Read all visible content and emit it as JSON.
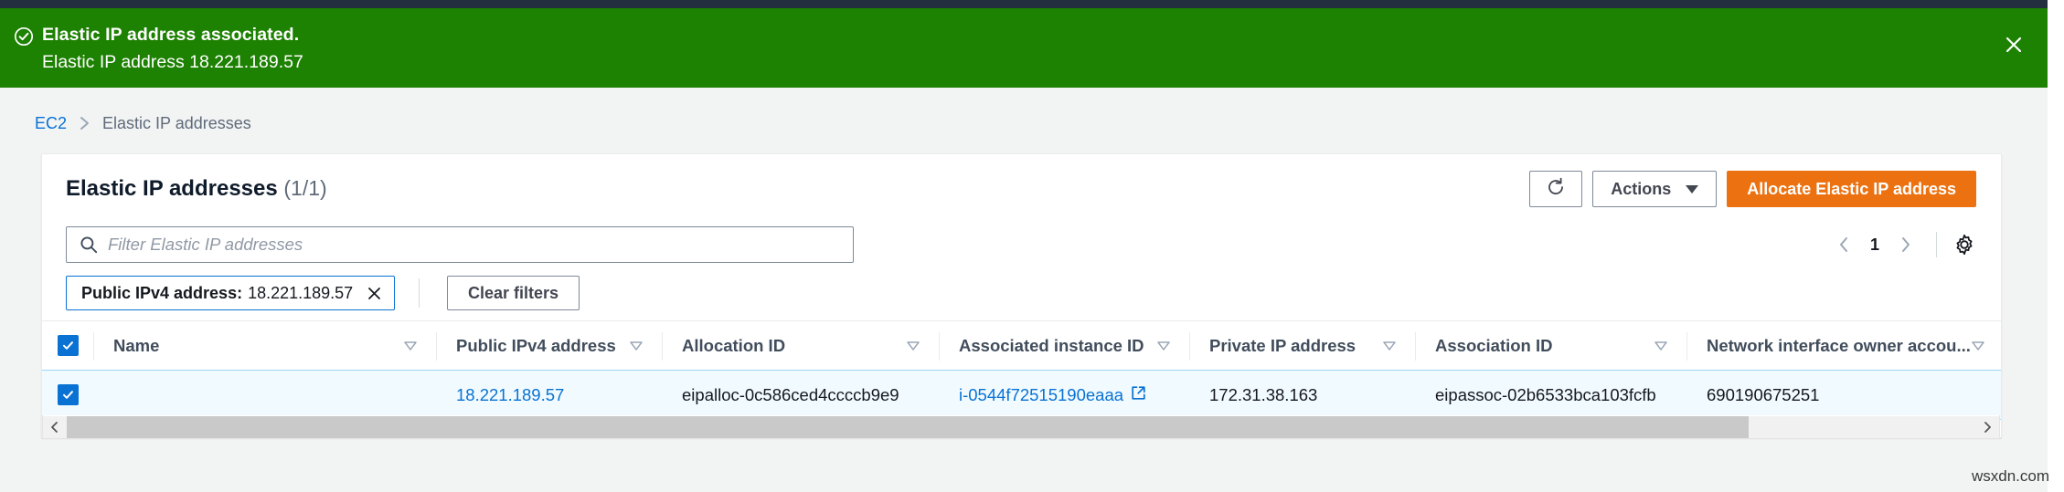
{
  "flash": {
    "title": "Elastic IP address associated.",
    "subtitle": "Elastic IP address 18.221.189.57",
    "status_color": "#1d8102",
    "icon": "check-circle-icon",
    "close_icon": "close-icon"
  },
  "breadcrumb": {
    "root": "EC2",
    "current": "Elastic IP addresses"
  },
  "panel": {
    "title": "Elastic IP addresses",
    "count": "(1/1)",
    "refresh_icon": "refresh-icon",
    "actions_label": "Actions",
    "allocate_label": "Allocate Elastic IP address",
    "allocate_color": "#ec7211"
  },
  "search": {
    "icon": "search-icon",
    "placeholder": "Filter Elastic IP addresses",
    "value": ""
  },
  "pagination": {
    "prev_icon": "chevron-left-icon",
    "page": "1",
    "next_icon": "chevron-right-icon",
    "settings_icon": "gear-icon"
  },
  "filters": {
    "token_key": "Public IPv4 address:",
    "token_value": "18.221.189.57",
    "token_remove_icon": "close-icon",
    "clear_label": "Clear filters"
  },
  "table": {
    "select_all_checked": true,
    "sort_icon": "sort-descending-icon",
    "columns": [
      {
        "label": "Name",
        "sortable": true
      },
      {
        "label": "Public IPv4 address",
        "sortable": true
      },
      {
        "label": "Allocation ID",
        "sortable": true
      },
      {
        "label": "Associated instance ID",
        "sortable": true
      },
      {
        "label": "Private IP address",
        "sortable": true
      },
      {
        "label": "Association ID",
        "sortable": true
      },
      {
        "label": "Network interface owner accou...",
        "sortable": true
      }
    ],
    "rows": [
      {
        "selected": true,
        "name": "",
        "public_ipv4": "18.221.189.57",
        "allocation_id": "eipalloc-0c586ced4ccccb9e9",
        "associated_instance_id": "i-0544f72515190eaaa",
        "instance_external_icon": "external-link-icon",
        "private_ip": "172.31.38.163",
        "association_id": "eipassoc-02b6533bca103fcfb",
        "owner_account": "690190675251"
      }
    ]
  },
  "scrollbar": {
    "left_icon": "chevron-left-icon",
    "right_icon": "chevron-right-icon"
  },
  "watermark": "wsxdn.com"
}
